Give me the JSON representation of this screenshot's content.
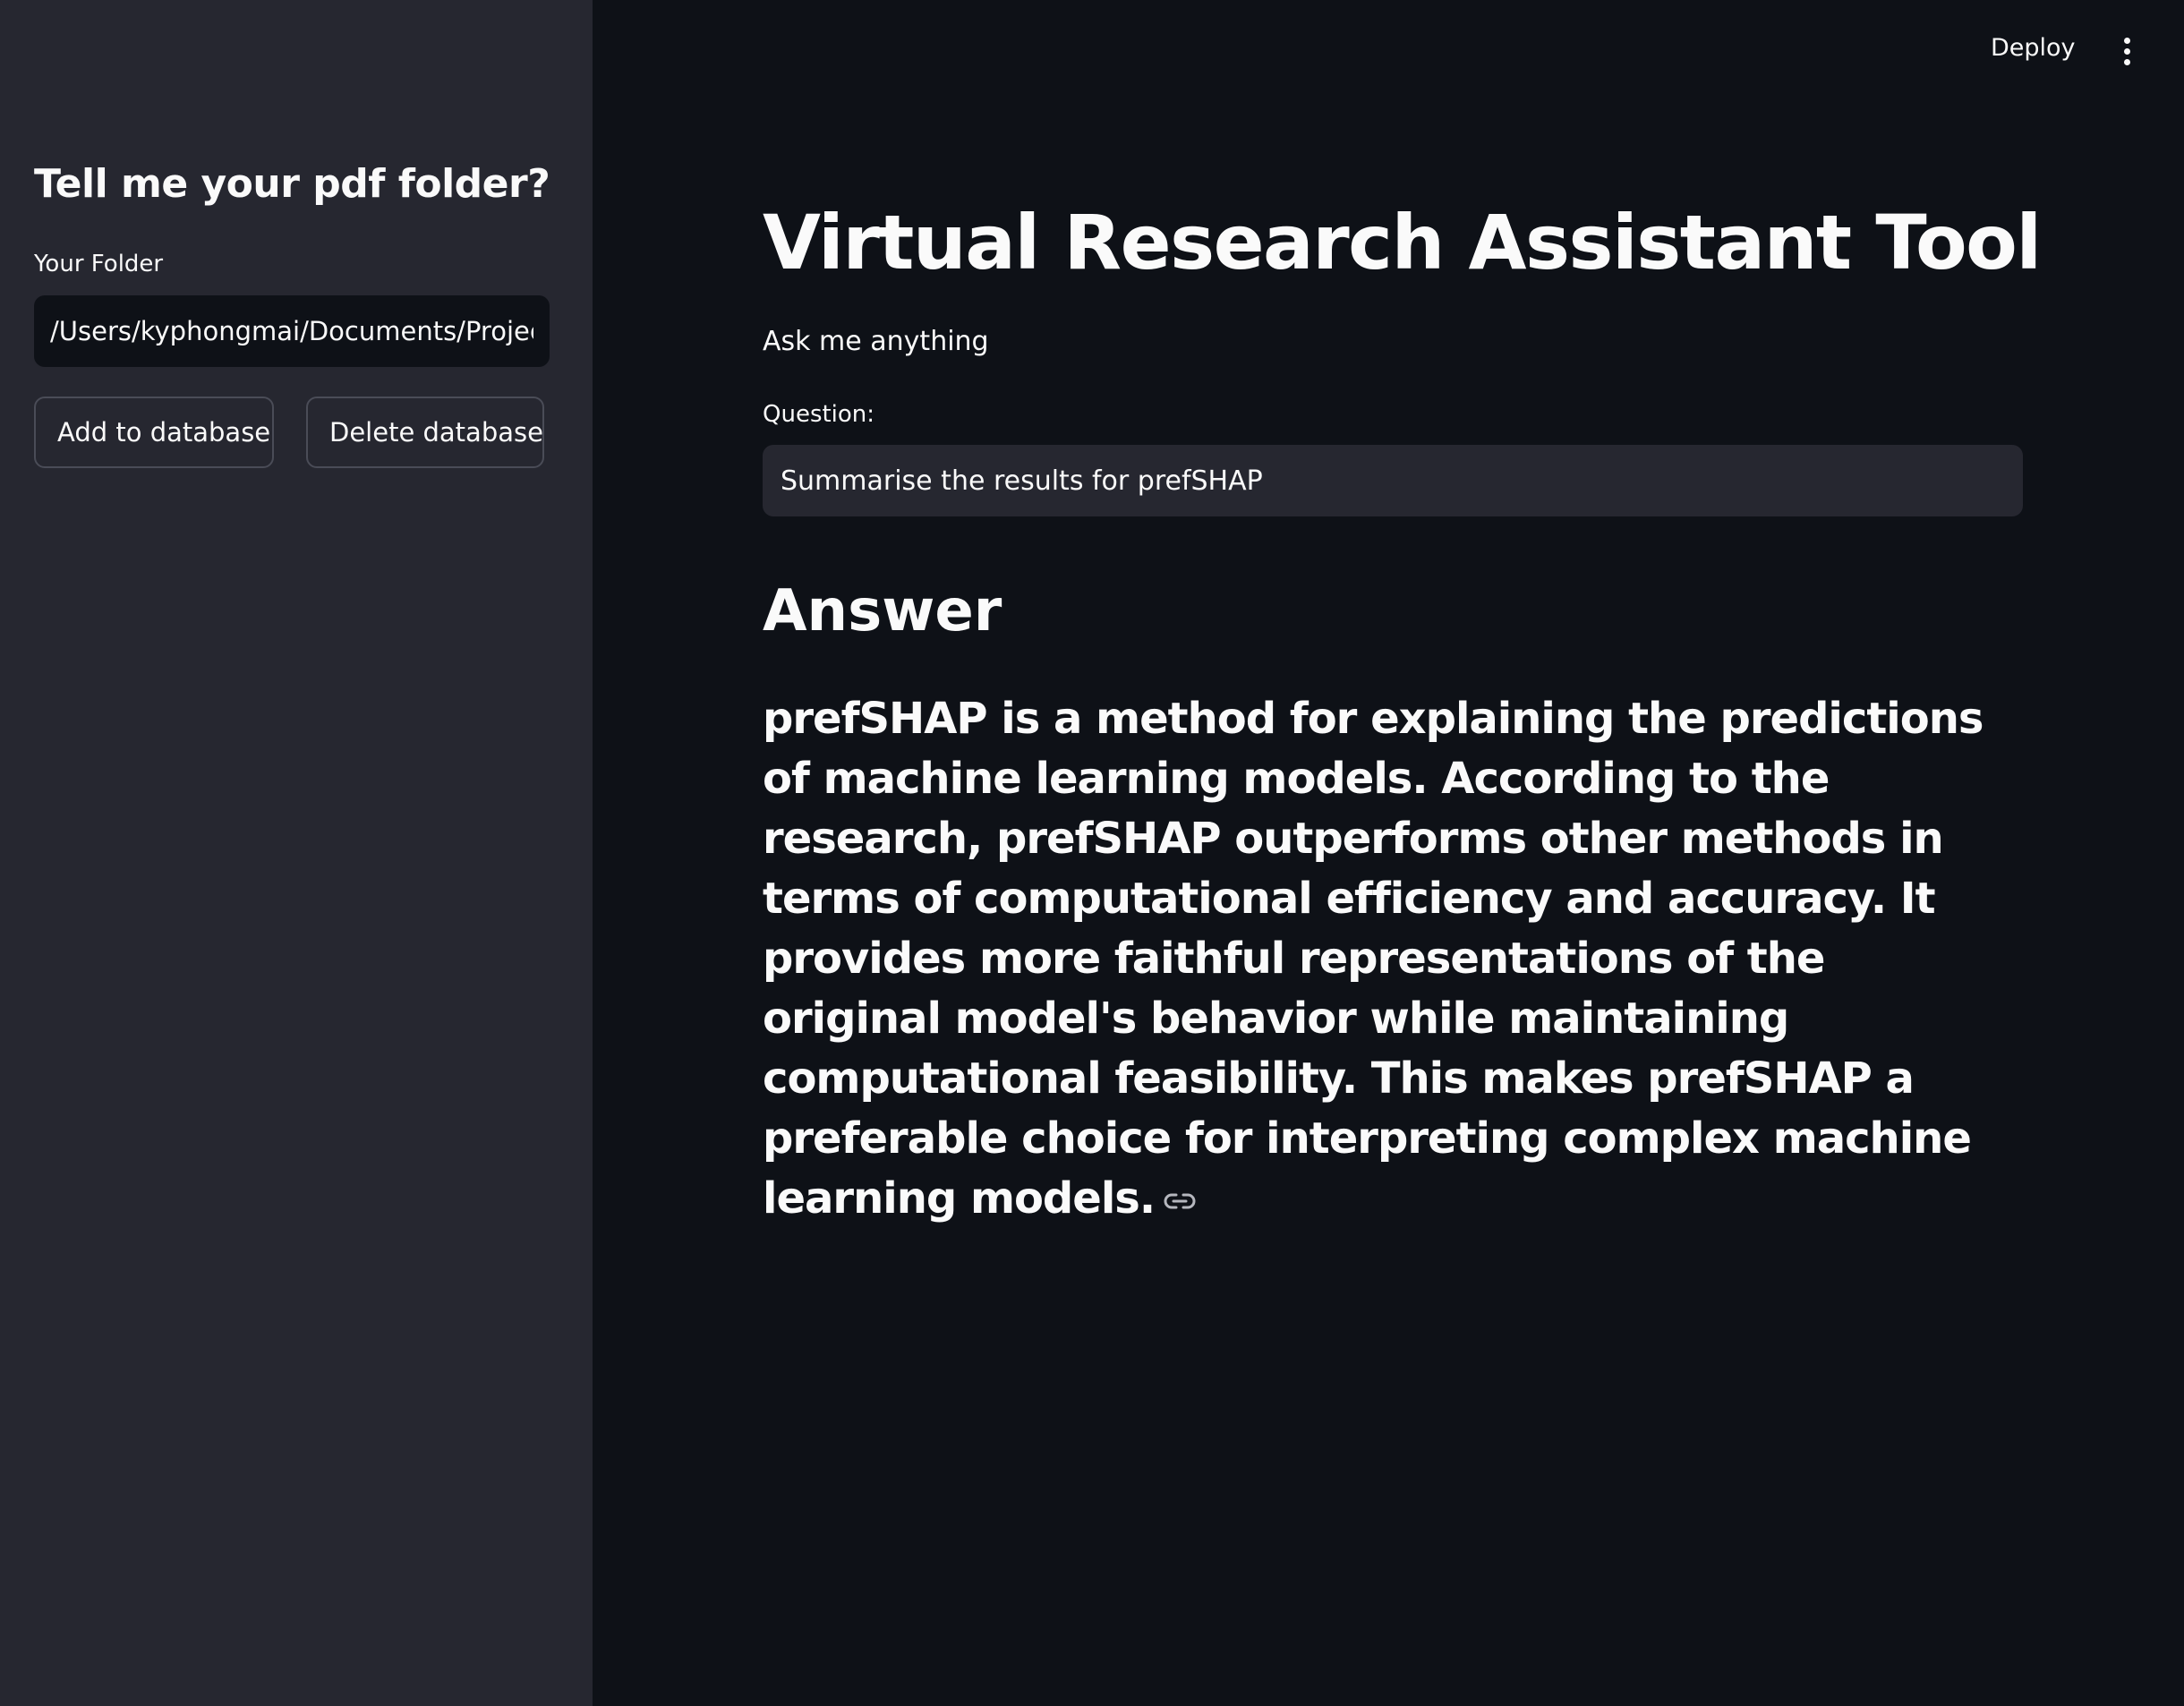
{
  "header": {
    "deploy_label": "Deploy",
    "menu_icon": "more-vertical-icon"
  },
  "sidebar": {
    "title": "Tell me your pdf folder?",
    "folder_label": "Your Folder",
    "folder_value": "/Users/kyphongmai/Documents/Projects",
    "add_button_label": "Add to database",
    "delete_button_label": "Delete database"
  },
  "main": {
    "title": "Virtual Research Assistant Tool",
    "subtitle": "Ask me anything",
    "question_label": "Question:",
    "question_value": "Summarise the results for prefSHAP",
    "answer_heading": "Answer",
    "answer_text": "prefSHAP is a method for explaining the predictions of machine learning models. According to the research, prefSHAP outperforms other methods in terms of computational efficiency and accuracy. It provides more faithful representations of the original model's behavior while maintaining computational feasibility. This makes prefSHAP a preferable choice for interpreting complex machine learning models.",
    "link_icon": "link-icon"
  },
  "colors": {
    "main_background": "#0e1117",
    "sidebar_background": "#262730",
    "text": "#fafafa",
    "button_border": "#4a4c57"
  }
}
